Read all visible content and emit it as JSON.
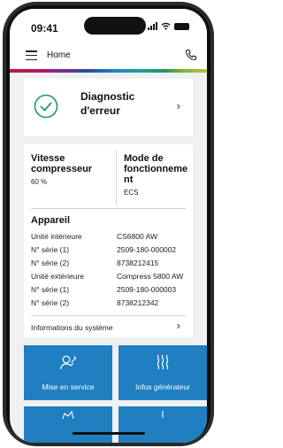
{
  "status": {
    "time": "09:41"
  },
  "header": {
    "title": "Home"
  },
  "diagnostic": {
    "line1": "Diagnostic",
    "line2": "d'erreur"
  },
  "compressor": {
    "title_line1": "Vitesse",
    "title_line2": "compresseur",
    "value": "60 %"
  },
  "mode": {
    "title_line1": "Mode de",
    "title_line2": "fonctionneme",
    "title_line3": "nt",
    "value": "ECS"
  },
  "device": {
    "title": "Appareil",
    "rows": [
      {
        "label": "Unité intérieure",
        "value": "CS6800 AW"
      },
      {
        "label": "N° série (1)",
        "value": "2509-180-000002"
      },
      {
        "label": "N° série (2)",
        "value": "8738212415"
      },
      {
        "label": "Unité extérieure",
        "value": "Compress 5800 AW"
      },
      {
        "label": "N° série (1)",
        "value": "2509-180-000003"
      },
      {
        "label": "N° série (2)",
        "value": "8738212342"
      }
    ]
  },
  "system_info": {
    "label": "Informations du système"
  },
  "tiles": [
    {
      "label": "Mise en service",
      "icon": "person-wrench-icon"
    },
    {
      "label": "Infos générateur",
      "icon": "heat-waves-icon"
    }
  ],
  "colors": {
    "accent": "#1f7fc0",
    "check": "#1f9a5a",
    "background": "#eef0f2"
  }
}
